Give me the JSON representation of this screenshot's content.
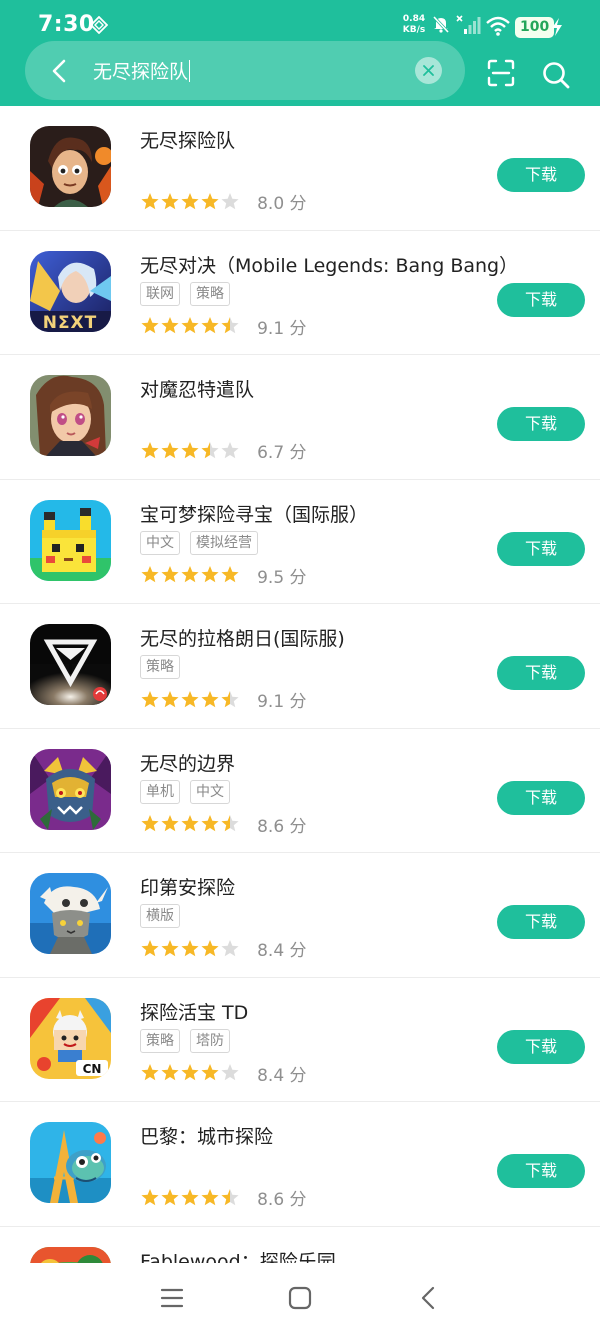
{
  "status_bar": {
    "time": "7:30",
    "speed_value": "0.84",
    "speed_unit": "KB/s",
    "battery": "100"
  },
  "search": {
    "query": "无尽探险队"
  },
  "colors": {
    "accent": "#1fbf9c",
    "star": "#f7b826",
    "star_empty": "#dcdcdc"
  },
  "download_label": "下载",
  "score_unit": "分",
  "apps": [
    {
      "name": "无尽探险队",
      "tags": [],
      "rating": 4,
      "score": "8.0",
      "icon": "hero-portrait-icon"
    },
    {
      "name": "无尽对决（Mobile Legends: Bang Bang）",
      "tags": [
        "联网",
        "策略"
      ],
      "rating": 4.5,
      "score": "9.1",
      "icon": "warrior-next-icon"
    },
    {
      "name": "对魔忍特遣队",
      "tags": [],
      "rating": 3.5,
      "score": "6.7",
      "icon": "anime-girl-icon"
    },
    {
      "name": "宝可梦探险寻宝（国际服）",
      "tags": [
        "中文",
        "模拟经营"
      ],
      "rating": 5,
      "score": "9.5",
      "icon": "cube-pikachu-icon"
    },
    {
      "name": "无尽的拉格朗日(国际服)",
      "tags": [
        "策略"
      ],
      "rating": 4.5,
      "score": "9.1",
      "icon": "lagrange-emblem-icon"
    },
    {
      "name": "无尽的边界",
      "tags": [
        "单机",
        "中文"
      ],
      "rating": 4.5,
      "score": "8.6",
      "icon": "armored-beast-icon"
    },
    {
      "name": "印第安探险",
      "tags": [
        "横版"
      ],
      "rating": 4,
      "score": "8.4",
      "icon": "skull-cat-icon"
    },
    {
      "name": "探险活宝 TD",
      "tags": [
        "策略",
        "塔防"
      ],
      "rating": 4,
      "score": "8.4",
      "icon": "adventure-time-icon"
    },
    {
      "name": "巴黎：城市探险",
      "tags": [],
      "rating": 4.5,
      "score": "8.6",
      "icon": "eiffel-creature-icon"
    },
    {
      "name": "Fablewood：探险乐园",
      "tags": [],
      "rating": 0,
      "score": "",
      "icon": "fablewood-icon"
    }
  ]
}
